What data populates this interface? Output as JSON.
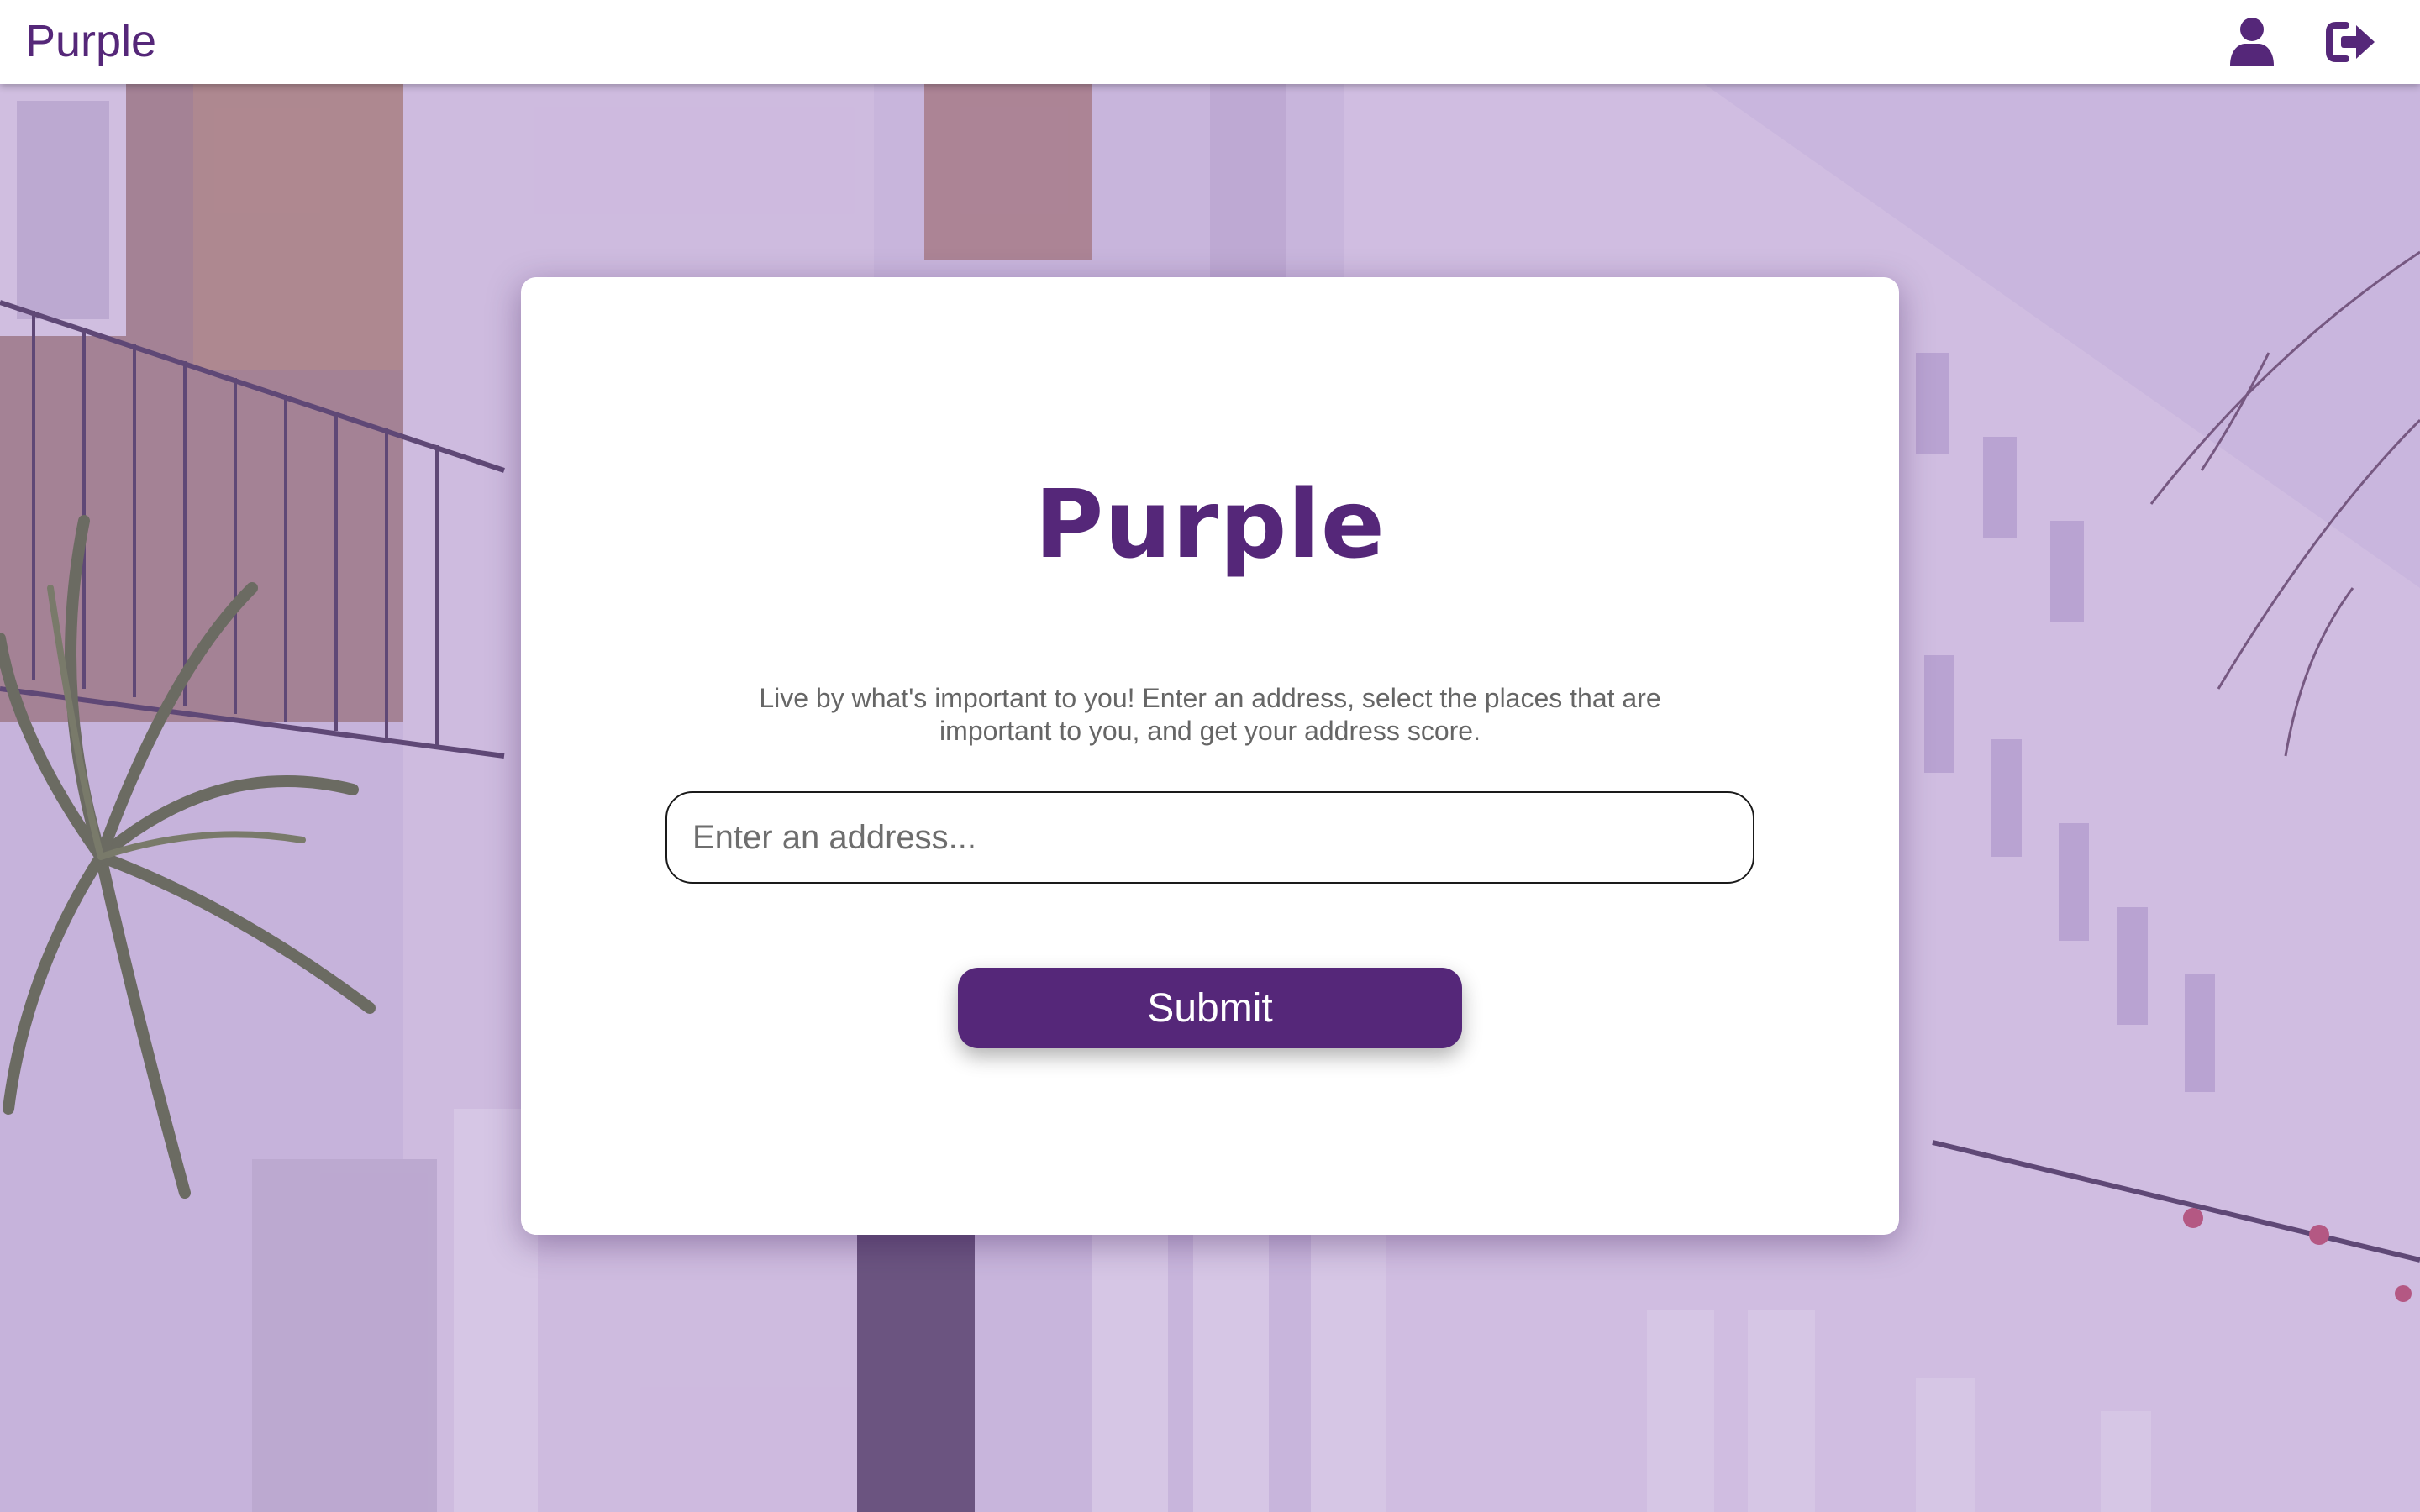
{
  "header": {
    "brand": "Purple",
    "profile_icon": "user-icon",
    "logout_icon": "sign-out-icon"
  },
  "card": {
    "title": "Purple",
    "description": "Live by what's important to you! Enter an address, select the places that are important to you, and get your address score.",
    "address_input": {
      "placeholder": "Enter an address...",
      "value": ""
    },
    "submit_label": "Submit"
  },
  "colors": {
    "brand": "#552779",
    "card_background": "#ffffff",
    "description_text": "#666666"
  }
}
